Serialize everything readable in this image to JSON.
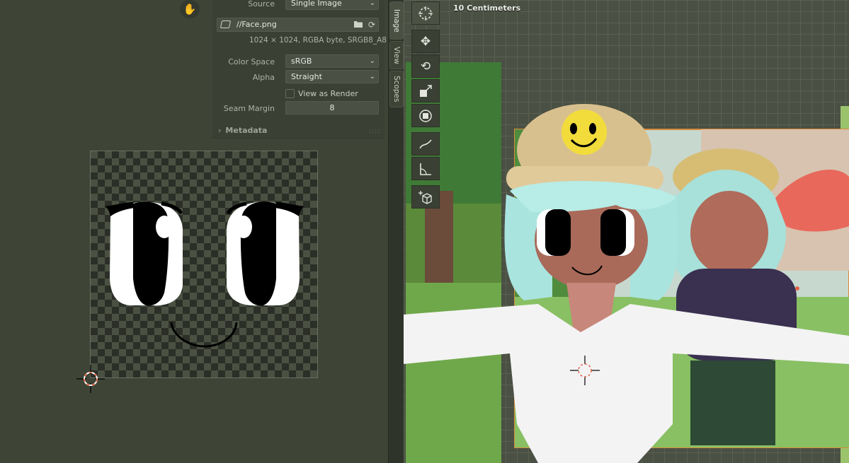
{
  "image_panel": {
    "source_label": "Source",
    "source_value": "Single Image",
    "file_name": "//Face.png",
    "image_info": "1024 × 1024,  RGBA byte, SRGB8_A8",
    "color_space_label": "Color Space",
    "color_space_value": "sRGB",
    "alpha_label": "Alpha",
    "alpha_value": "Straight",
    "view_as_render_label": "View as Render",
    "view_as_render_checked": false,
    "seam_margin_label": "Seam Margin",
    "seam_margin_value": "8",
    "metadata_label": "Metadata"
  },
  "side_tabs": [
    "Image",
    "View",
    "Scopes"
  ],
  "viewport": {
    "scale_label": "10 Centimeters",
    "tools": [
      "cursor-tool-icon",
      "move-icon",
      "rotate-icon",
      "scale-icon",
      "transform-icon",
      "annotate-icon",
      "measure-icon",
      "add-cube-icon"
    ]
  },
  "colors": {
    "panel_bg": "#3a4034",
    "editor_bg": "#3e4537",
    "field_bg": "#4a5043",
    "accent": "#e0664a"
  }
}
